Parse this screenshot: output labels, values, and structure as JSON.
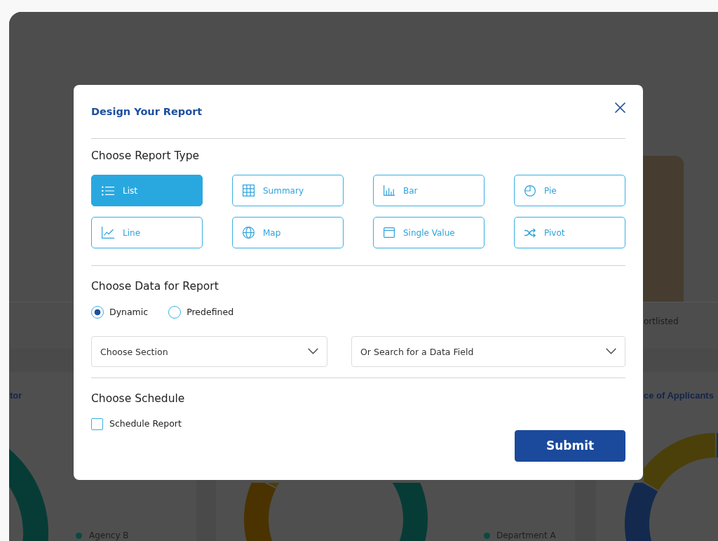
{
  "background": {
    "top_card": {
      "bar_label": "ortlisted"
    },
    "cards": [
      {
        "title": "tor",
        "legend": [
          {
            "label": "Agency B",
            "color": "#0b4a40"
          }
        ]
      },
      {
        "legend": [
          {
            "label": "Department A",
            "color": "#0b4a40"
          }
        ]
      },
      {
        "title": "ce of Applicants"
      }
    ]
  },
  "modal": {
    "title": "Design Your Report",
    "report_type": {
      "heading": "Choose Report Type",
      "options": [
        {
          "label": "List",
          "selected": true
        },
        {
          "label": "Summary",
          "selected": false
        },
        {
          "label": "Bar",
          "selected": false
        },
        {
          "label": "Pie",
          "selected": false
        },
        {
          "label": "Line",
          "selected": false
        },
        {
          "label": "Map",
          "selected": false
        },
        {
          "label": "Single Value",
          "selected": false
        },
        {
          "label": "Pivot",
          "selected": false
        }
      ]
    },
    "data": {
      "heading": "Choose Data for Report",
      "sources": [
        {
          "label": "Dynamic",
          "selected": true
        },
        {
          "label": "Predefined",
          "selected": false
        }
      ],
      "fields": [
        {
          "placeholder": "Choose Section"
        },
        {
          "placeholder": "Or Search for a Data Field"
        }
      ]
    },
    "schedule": {
      "heading": "Choose Schedule",
      "option": {
        "label": "Schedule Report",
        "checked": false
      }
    },
    "submit": "Submit"
  }
}
